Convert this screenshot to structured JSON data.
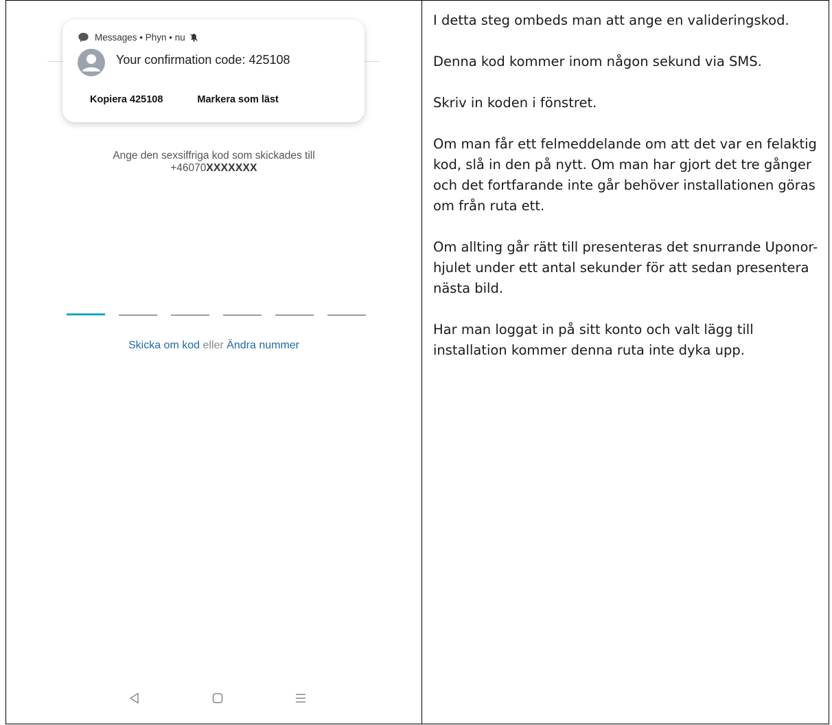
{
  "phone": {
    "notification": {
      "app": "Messages",
      "sender": "Phyn",
      "time": "nu",
      "header": "Messages • Phyn • nu",
      "message": "Your confirmation code: 425108",
      "actions": {
        "copy": "Kopiera 425108",
        "mark_read": "Markera som läst"
      }
    },
    "prompt": {
      "line1": "Ange den sexsiffriga kod som skickades till",
      "number_prefix": "+46070",
      "number_masked": "XXXXXXX"
    },
    "code_input": {
      "slots": [
        "",
        "",
        "",
        "",
        "",
        ""
      ],
      "active_index": 0,
      "active_color": "#1ba6c8"
    },
    "links": {
      "resend": "Skicka om kod",
      "or": "eller",
      "change_number": "Ändra nummer"
    },
    "navbar": {
      "icons": [
        "back-icon",
        "home-icon",
        "menu-icon"
      ]
    }
  },
  "instructions": {
    "p1": "I detta steg ombeds man att ange en valideringskod.",
    "p2": "Denna kod kommer inom någon sekund via SMS.",
    "p3": "Skriv in koden i fönstret.",
    "p4": "Om man får ett felmeddelande om att det var en felaktig kod, slå in den på nytt. Om man har gjort det tre gånger och det fortfarande inte går behöver installationen göras om från ruta ett.",
    "p5": "Om allting går rätt till presenteras det snurrande Uponor-hjulet under ett antal sekunder för att sedan presentera nästa bild.",
    "p6": "Har man loggat in på sitt konto och valt lägg till installation kommer denna ruta inte dyka upp."
  }
}
